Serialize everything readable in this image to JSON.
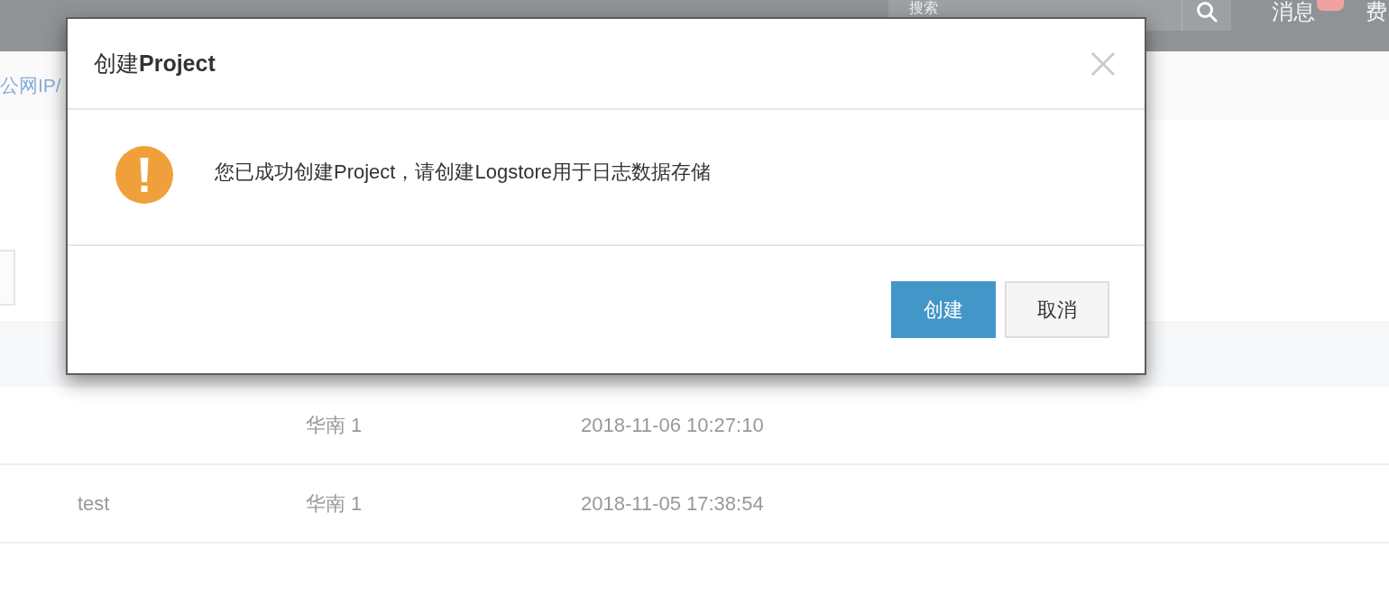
{
  "top_bar": {
    "search": {
      "placeholder": "搜索"
    },
    "messages": {
      "label": "消息",
      "badge": true
    },
    "item_cut": "费"
  },
  "breadcrumb": {
    "text": "公网IP/"
  },
  "table": {
    "rows": [
      {
        "column_2": "华南 1",
        "column_3": "2018-11-06 10:27:10"
      },
      {
        "column_1": "test",
        "column_2": "华南 1",
        "column_3": "2018-11-05 17:38:54"
      }
    ]
  },
  "dialog": {
    "title": "创建**Project**",
    "message": {
      "kind": "warning",
      "text": "您已成功创建Project，请创建Logstore用于日志数据存储"
    },
    "buttons": [
      {
        "label": "创建",
        "kind": "primary"
      },
      {
        "label": "取消",
        "kind": "default"
      }
    ]
  }
}
